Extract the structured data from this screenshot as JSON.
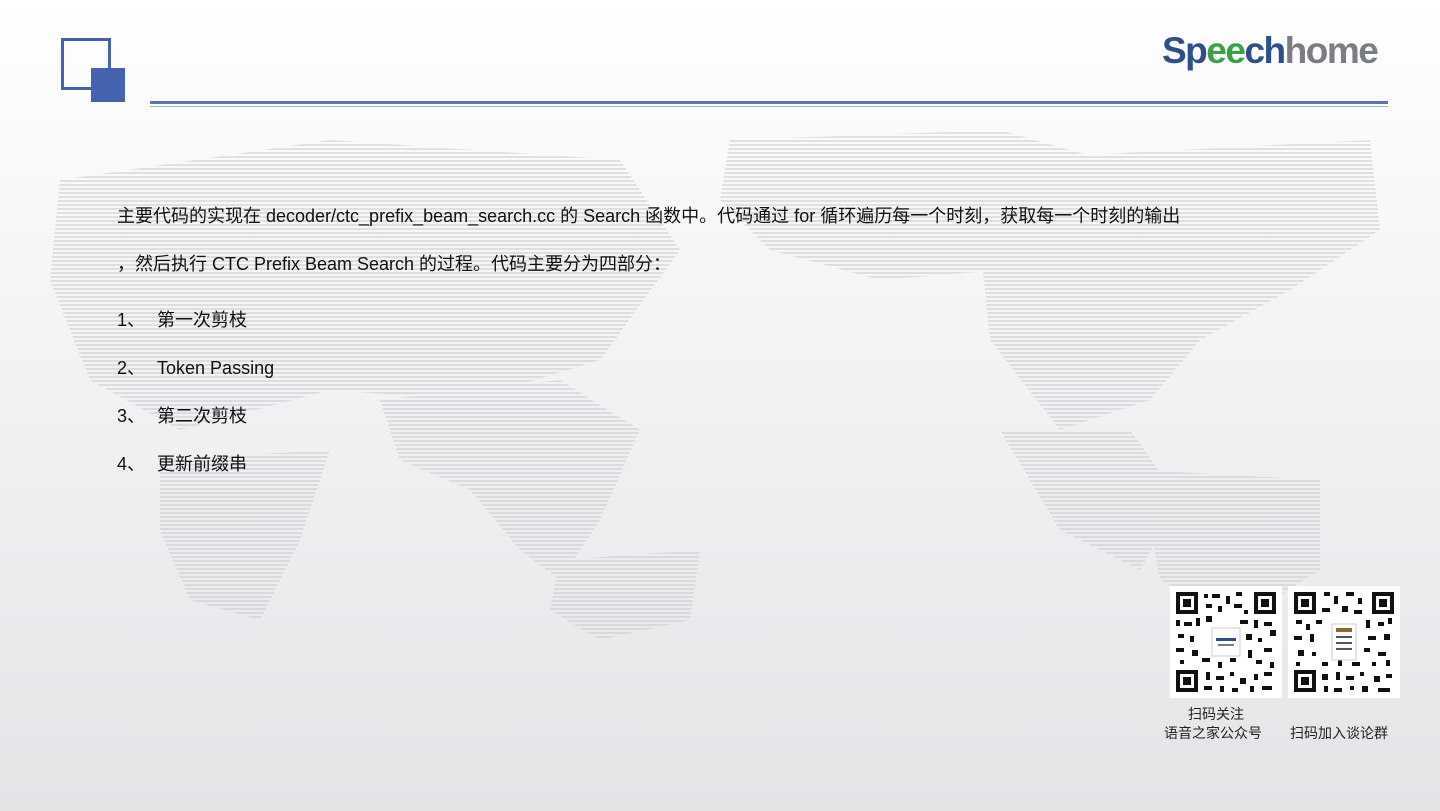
{
  "brand": {
    "part1": "Sp",
    "part2": "ee",
    "part3": "ch",
    "part4": "home",
    "colors": {
      "blue": "#2f4f8c",
      "green": "#3ea046",
      "gray": "#7a7d83",
      "accent": "#4462ae"
    }
  },
  "content": {
    "paragraph_line1": "主要代码的实现在  decoder/ctc_prefix_beam_search.cc  的 Search 函数中。代码通过 for 循环遍历每一个时刻，获取每一个时刻的输出",
    "paragraph_line2": "，然后执行 CTC Prefix Beam Search 的过程。代码主要分为四部分：",
    "items": [
      {
        "num": "1、",
        "text": "第一次剪枝"
      },
      {
        "num": "2、",
        "text": "Token Passing"
      },
      {
        "num": "3、",
        "text": "第二次剪枝"
      },
      {
        "num": "4、",
        "text": "更新前缀串"
      }
    ]
  },
  "qr": {
    "caption1_line1": "扫码关注",
    "caption1_line2": "语音之家公众号",
    "caption2": "扫码加入谈论群",
    "icons": [
      "qr-code-icon",
      "qr-code-icon"
    ]
  }
}
